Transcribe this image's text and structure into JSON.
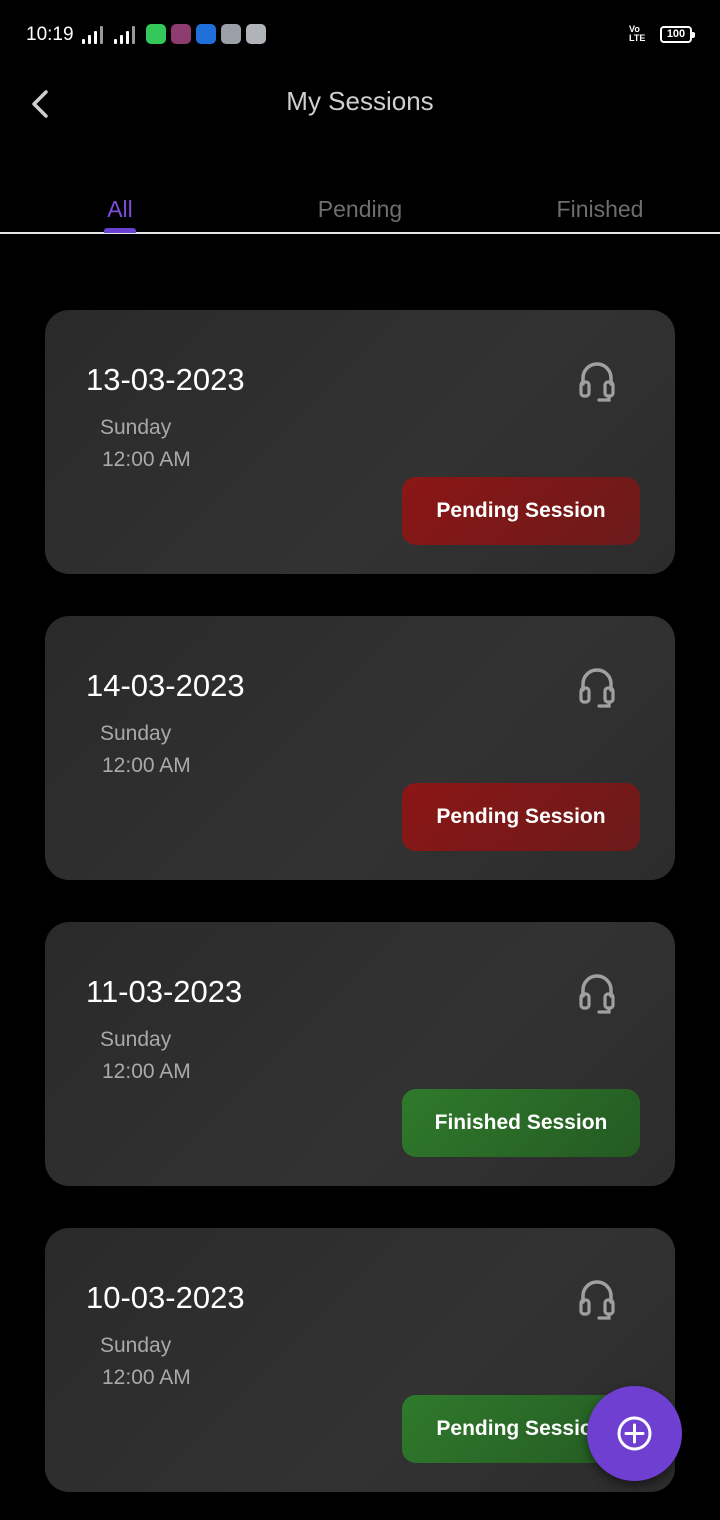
{
  "status_bar": {
    "time": "10:19",
    "volte": "Vo LTE",
    "battery": "100"
  },
  "header": {
    "title": "My Sessions",
    "back_icon": "chevron-left-icon"
  },
  "tabs": [
    {
      "label": "All",
      "active": true
    },
    {
      "label": "Pending",
      "active": false
    },
    {
      "label": "Finished",
      "active": false
    }
  ],
  "sessions": [
    {
      "date": "13-03-2023",
      "day": "Sunday",
      "time": "12:00 AM",
      "status": "Pending Session",
      "status_color": "#8c1616",
      "icon": "headphones-icon"
    },
    {
      "date": "14-03-2023",
      "day": "Sunday",
      "time": "12:00 AM",
      "status": "Pending Session",
      "status_color": "#8c1616",
      "icon": "headphones-icon"
    },
    {
      "date": "11-03-2023",
      "day": "Sunday",
      "time": "12:00 AM",
      "status": "Finished Session",
      "status_color": "#2f7a2c",
      "icon": "headphones-icon"
    },
    {
      "date": "10-03-2023",
      "day": "Sunday",
      "time": "12:00 AM",
      "status": "Pending Session",
      "status_color": "#2f7a2c",
      "icon": "headphones-icon"
    }
  ],
  "fab": {
    "icon": "add-circle-icon",
    "color": "#6e3fd1"
  },
  "colors": {
    "accent": "#7c4ddb",
    "background": "#000000",
    "card": "#2e2e2e"
  }
}
